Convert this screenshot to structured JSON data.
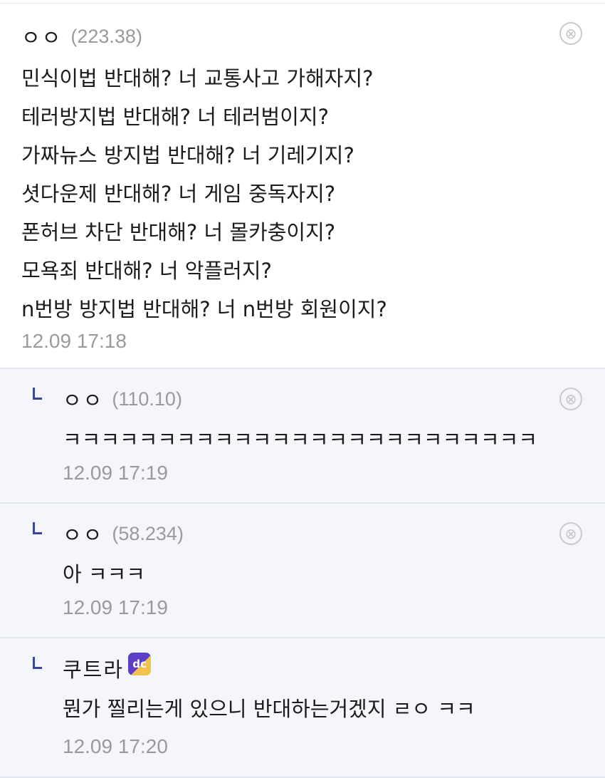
{
  "comments": [
    {
      "nick": "ㅇㅇ",
      "ip": "(223.38)",
      "lines": [
        "민식이법 반대해? 너 교통사고 가해자지?",
        "테러방지법 반대해? 너 테러범이지?",
        "가짜뉴스 방지법 반대해? 너 기레기지?",
        "셧다운제 반대해? 너 게임 중독자지?",
        "폰허브 차단 반대해? 너 몰카충이지?",
        "모욕죄 반대해? 너 악플러지?",
        "n번방 방지법 반대해? 너 n번방 회원이지?"
      ],
      "time": "12.09 17:18",
      "delete_icon": "⊗"
    },
    {
      "nick": "ㅇㅇ",
      "ip": "(110.10)",
      "text": "ㅋㅋㅋㅋㅋㅋㅋㅋㅋㅋㅋㅋㅋㅋㅋㅋㅋㅋㅋㅋㅋㅋㅋㅋㅋ",
      "time": "12.09 17:19",
      "delete_icon": "⊗"
    },
    {
      "nick": "ㅇㅇ",
      "ip": "(58.234)",
      "text": "아 ㅋㅋㅋ",
      "time": "12.09 17:19",
      "delete_icon": "⊗"
    },
    {
      "nick": "쿠트라",
      "badge": "dc",
      "text": "뭔가 찔리는게 있으니 반대하는거겠지 ㄹㅇ ㅋㅋ",
      "time": "12.09 17:20"
    }
  ],
  "icons": {
    "delete": "close-circle-icon",
    "reply": "reply-arrow-icon",
    "badge": "gallery-badge-icon"
  },
  "colors": {
    "reply_bg": "#f5f6fb",
    "reply_mark": "#3a4596",
    "muted_text": "#9a9a9a",
    "badge_purple": "#5b3fc4",
    "badge_yellow": "#f2c14e"
  }
}
